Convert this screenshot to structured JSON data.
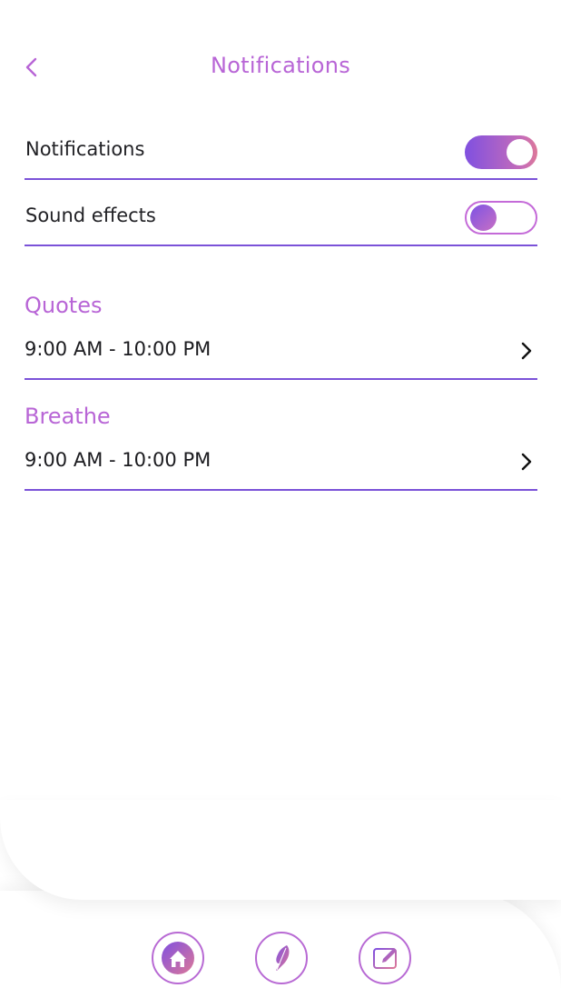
{
  "header": {
    "title": "Notifications",
    "back_icon": "chevron-left-icon"
  },
  "settings": [
    {
      "label": "Notifications",
      "enabled": true
    },
    {
      "label": "Sound effects",
      "enabled": false
    }
  ],
  "schedules": [
    {
      "title": "Quotes",
      "time_range": "9:00 AM - 10:00 PM"
    },
    {
      "title": "Breathe",
      "time_range": "9:00 AM - 10:00 PM"
    }
  ],
  "nav": [
    {
      "icon": "home-icon"
    },
    {
      "icon": "feather-icon"
    },
    {
      "icon": "journal-edit-icon"
    }
  ],
  "colors": {
    "accent": "#b865d6",
    "divider": "#7b52d8",
    "gradient_start": "#8050e0",
    "gradient_end": "#dd7898"
  }
}
